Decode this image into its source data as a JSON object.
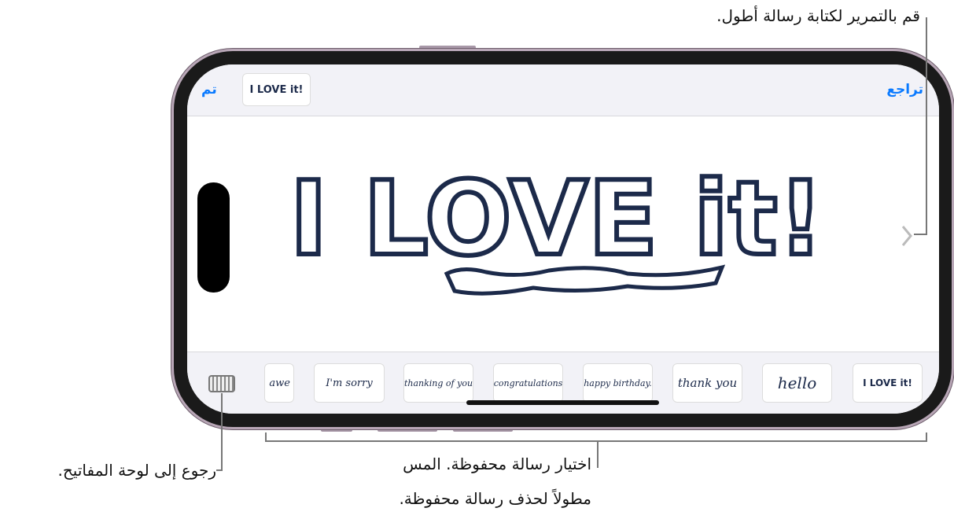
{
  "topbar": {
    "done_label": "تم",
    "undo_label": "تراجع",
    "preview_text": "I LOVE it!"
  },
  "canvas": {
    "message": "I LOVE it!",
    "next_icon": "chevron-right-icon"
  },
  "saved_messages": [
    "awe",
    "I'm sorry",
    "thanking of you",
    "congratulations",
    "happy birthday.",
    "thank you",
    "hello",
    "I LOVE it!"
  ],
  "keyboard_icon": "keyboard-icon",
  "callouts": {
    "scroll": "قم بالتمرير لكتابة رسالة أطول.",
    "keyboard": "رجوع إلى لوحة المفاتيح.",
    "saved_line1": "اختيار رسالة محفوظة. المس",
    "saved_line2": "مطولاً لحذف رسالة محفوظة."
  },
  "colors": {
    "accent": "#0a7aff",
    "ink": "#1c2a4a"
  }
}
